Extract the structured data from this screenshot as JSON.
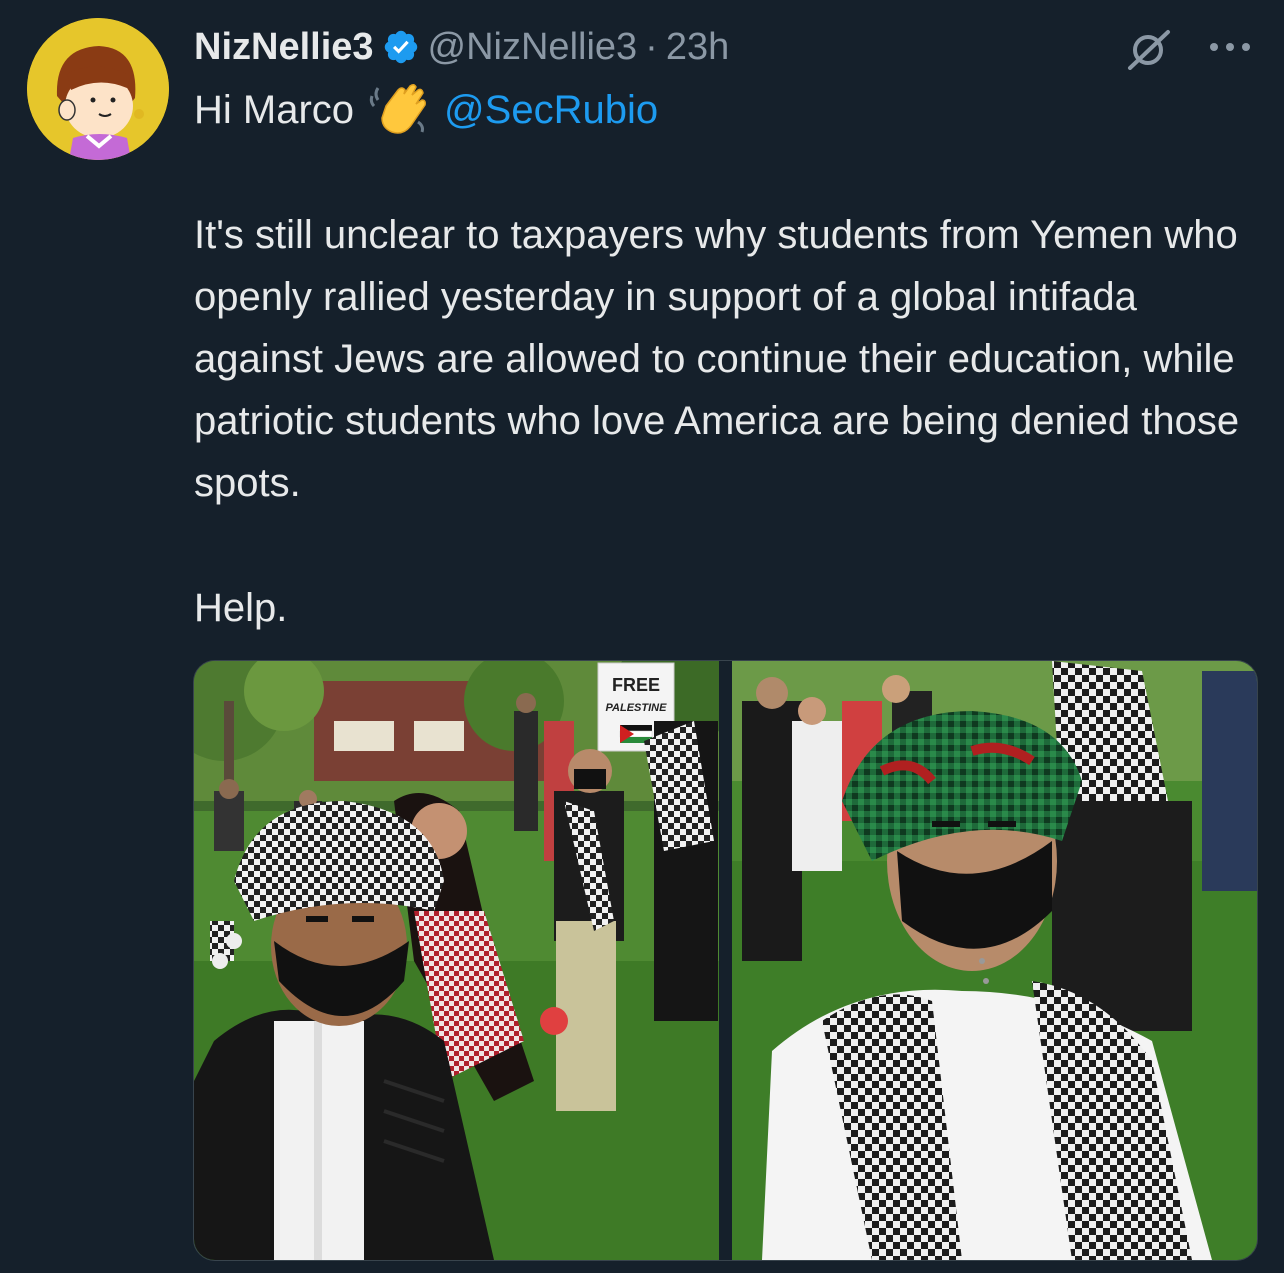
{
  "tweet": {
    "display_name": "NizNellie3",
    "handle": "@NizNellie3",
    "separator": "·",
    "timestamp": "23h",
    "greeting": "Hi Marco",
    "mention": "@SecRubio",
    "body": "It's still unclear to taxpayers why students from Yemen who openly rallied yesterday in support of a global intifada against Jews are allowed to continue their education, while patriotic students who love America are being denied those spots.",
    "closing": "Help."
  },
  "media": {
    "sign_text_line1": "FREE",
    "sign_text_line2": "PALESTINE"
  },
  "icons": {
    "verified": "verified-badge-icon",
    "grok": "grok-icon",
    "more": "more-icon",
    "wave": "waving-hand-emoji"
  },
  "colors": {
    "background": "#15202b",
    "text": "#e7e9ea",
    "secondary": "#8b98a5",
    "link": "#1d9bf0"
  }
}
